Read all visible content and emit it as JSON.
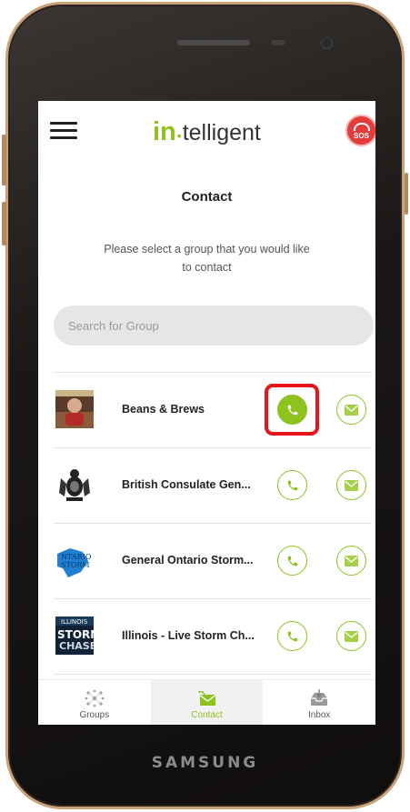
{
  "device": {
    "brand": "SAMSUNG"
  },
  "header": {
    "logo_prefix": "in",
    "logo_suffix": "telligent",
    "sos_label": "SOS"
  },
  "page": {
    "title": "Contact",
    "subtitle": "Please select a group that you would like to contact"
  },
  "search": {
    "placeholder": "Search for Group"
  },
  "contacts": [
    {
      "name": "Beans & Brews",
      "avatar_icon": "cafe-photo-avatar"
    },
    {
      "name": "British Consulate Gen...",
      "avatar_icon": "coat-of-arms-avatar"
    },
    {
      "name": "General Ontario Storm...",
      "avatar_icon": "ontario-storm-logo"
    },
    {
      "name": "Illinois - Live Storm Ch...",
      "avatar_icon": "storm-chasers-logo"
    }
  ],
  "tabs": [
    {
      "label": "Groups",
      "icon": "groups-network-icon"
    },
    {
      "label": "Contact",
      "icon": "contact-mail-icon"
    },
    {
      "label": "Inbox",
      "icon": "inbox-tray-icon"
    }
  ],
  "colors": {
    "accent": "#8dc21f",
    "sos": "#e53b3b",
    "highlight": "#e8141c"
  }
}
